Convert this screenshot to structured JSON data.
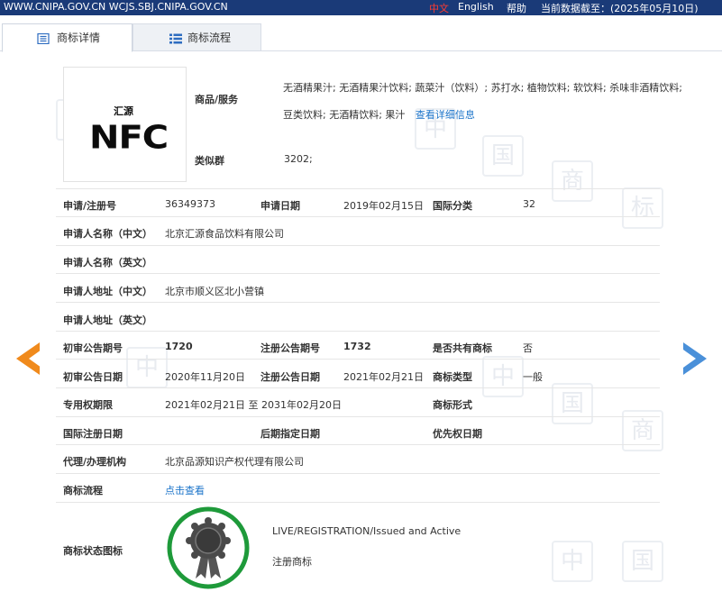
{
  "topbar": {
    "site": "WWW.CNIPA.GOV.CN  WCJS.SBJ.CNIPA.GOV.CN",
    "lang_cn": "中文",
    "lang_en": "English",
    "help": "帮助",
    "data_date": "当前数据截至：(2025年05月10日)"
  },
  "tabs": [
    {
      "label": "商标详情",
      "icon": "document-icon",
      "active": true
    },
    {
      "label": "商标流程",
      "icon": "list-icon",
      "active": false
    }
  ],
  "watermark_chars": [
    "中",
    "国",
    "商",
    "标"
  ],
  "logo": {
    "top_text": "汇源",
    "main_text": "NFC"
  },
  "goods": {
    "label": "商品/服务",
    "value": "无酒精果汁; 无酒精果汁饮料; 蔬菜汁（饮料）; 苏打水; 植物饮料; 软饮料; 杀味非酒精饮料; 豆类饮料; 无酒精饮料; 果汁",
    "link": "查看详细信息"
  },
  "similar_group": {
    "label": "类似群",
    "value": "3202;"
  },
  "fields": {
    "reg_no_label": "申请/注册号",
    "reg_no": "36349373",
    "app_date_label": "申请日期",
    "app_date": "2019年02月15日",
    "intl_class_label": "国际分类",
    "intl_class": "32",
    "applicant_cn_label": "申请人名称（中文）",
    "applicant_cn": "北京汇源食品饮料有限公司",
    "applicant_en_label": "申请人名称（英文）",
    "applicant_en": "",
    "address_cn_label": "申请人地址（中文）",
    "address_cn": "北京市顺义区北小营镇",
    "address_en_label": "申请人地址（英文）",
    "address_en": "",
    "prelim_no_label": "初审公告期号",
    "prelim_no": "1720",
    "reg_pub_no_label": "注册公告期号",
    "reg_pub_no": "1732",
    "shared_label": "是否共有商标",
    "shared": "否",
    "prelim_date_label": "初审公告日期",
    "prelim_date": "2020年11月20日",
    "reg_pub_date_label": "注册公告日期",
    "reg_pub_date": "2021年02月21日",
    "type_label": "商标类型",
    "type": "一般",
    "exclusive_label": "专用权期限",
    "exclusive": "2021年02月21日 至 2031年02月20日",
    "form_label": "商标形式",
    "form": "",
    "intl_reg_date_label": "国际注册日期",
    "intl_reg_date": "",
    "later_date_label": "后期指定日期",
    "later_date": "",
    "priority_label": "优先权日期",
    "priority": "",
    "agent_label": "代理/办理机构",
    "agent": "北京品源知识产权代理有限公司",
    "process_label": "商标流程",
    "process_link": "点击查看",
    "status_icon_label": "商标状态图标",
    "status_en": "LIVE/REGISTRATION/Issued and Active",
    "status_cn": "注册商标"
  },
  "colors": {
    "topbar_bg": "#1a3a78",
    "link": "#1a73c9",
    "prev_arrow": "#f08a1c",
    "next_arrow": "#4a90d9",
    "status_ring": "#1e9a3a"
  }
}
